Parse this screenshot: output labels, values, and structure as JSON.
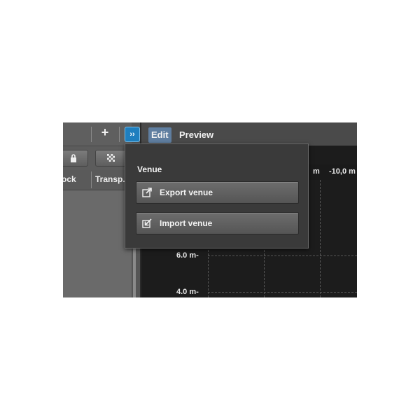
{
  "left_panel": {
    "add_label": "+",
    "expand_label": "››",
    "columns": [
      {
        "label": "ock"
      },
      {
        "label": "Transp..."
      }
    ]
  },
  "view": {
    "tabs": [
      {
        "label": "Edit",
        "active": true
      },
      {
        "label": "Preview",
        "active": false
      }
    ],
    "ruler_x": [
      "m",
      "-10,0 m"
    ],
    "ruler_y": [
      "6.0 m-",
      "4.0 m-"
    ]
  },
  "popup": {
    "section_title": "Venue",
    "export_label": "Export venue",
    "import_label": "Import venue",
    "export_icon": "export-arrow-icon",
    "import_icon": "import-arrow-icon"
  },
  "colors": {
    "accent_blue": "#1f7fbf",
    "tab_active": "#5f7ea0",
    "popup_bg": "#3a3a3a"
  }
}
